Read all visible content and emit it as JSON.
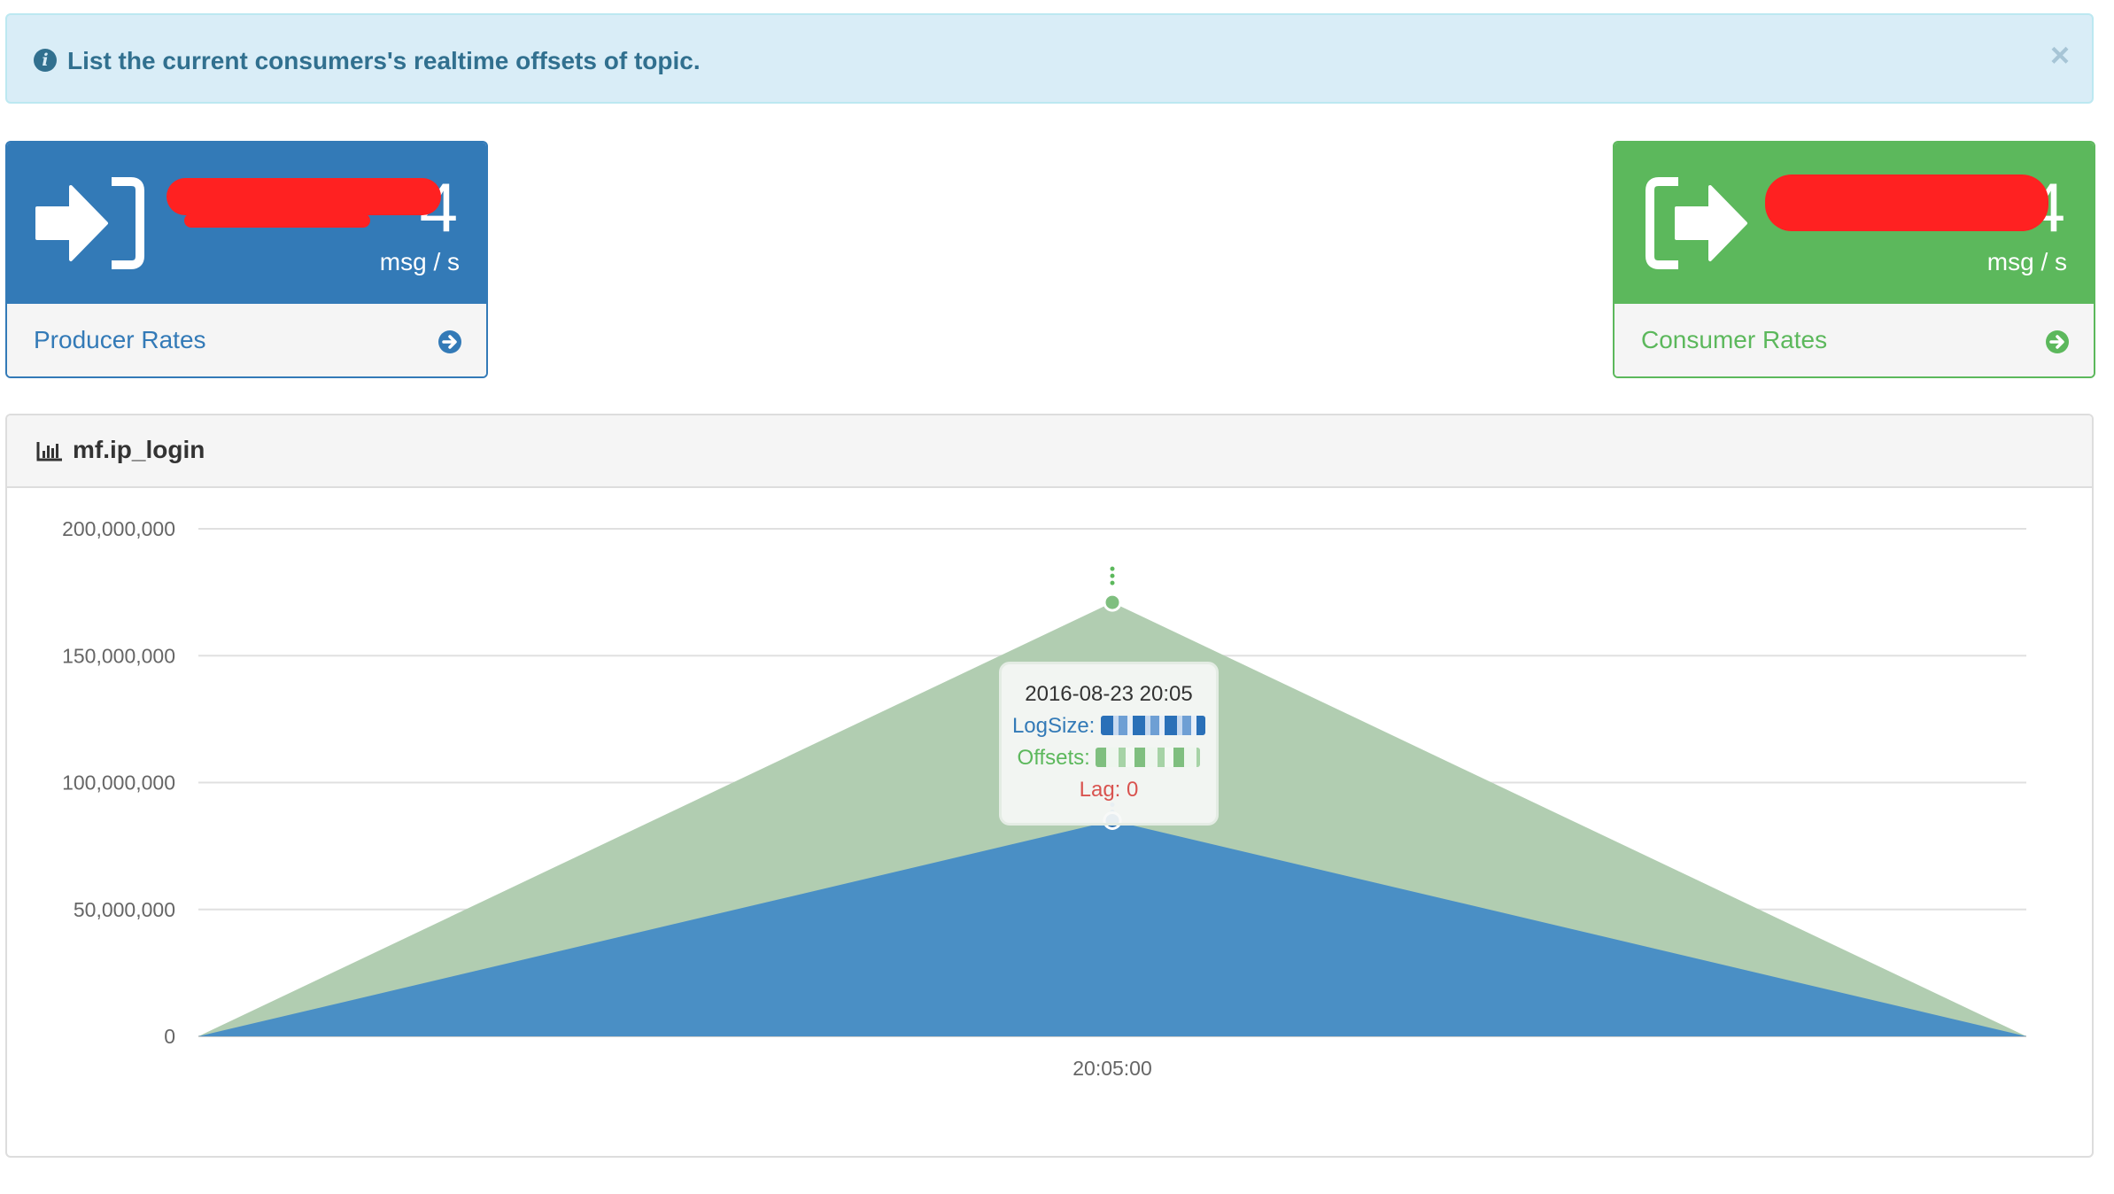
{
  "alert": {
    "icon": "info-circle-icon",
    "text": "List the current consumers's realtime offsets of topic.",
    "close_label": "×"
  },
  "producer_panel": {
    "icon": "sign-in-icon",
    "rate_value": "4",
    "unit": "msg / s",
    "footer_label": "Producer Rates",
    "footer_icon": "arrow-circle-right-icon",
    "color": "#337ab7"
  },
  "consumer_panel": {
    "icon": "sign-out-icon",
    "rate_value": "4",
    "unit": "msg / s",
    "footer_label": "Consumer Rates",
    "footer_icon": "arrow-circle-right-icon",
    "color": "#5cb85c"
  },
  "chart_panel": {
    "icon": "bar-chart-icon",
    "title": "mf.ip_login"
  },
  "chart_data": {
    "type": "area",
    "x": [
      "",
      "20:05:00",
      ""
    ],
    "series": [
      {
        "name": "LogSize",
        "color": "#4a8fc5",
        "values": [
          0,
          85000000,
          0
        ]
      },
      {
        "name": "Offsets",
        "color": "#b1cdb1",
        "values": [
          0,
          171000000,
          0
        ]
      }
    ],
    "y_ticks": [
      "0",
      "50,000,000",
      "100,000,000",
      "150,000,000",
      "200,000,000"
    ],
    "ylim": [
      0,
      200000000
    ],
    "grid": true,
    "legend": "none"
  },
  "tooltip": {
    "date": "2016-08-23 20:05",
    "logsize_label": "LogSize:",
    "offsets_label": "Offsets:",
    "lag": "Lag: 0"
  }
}
